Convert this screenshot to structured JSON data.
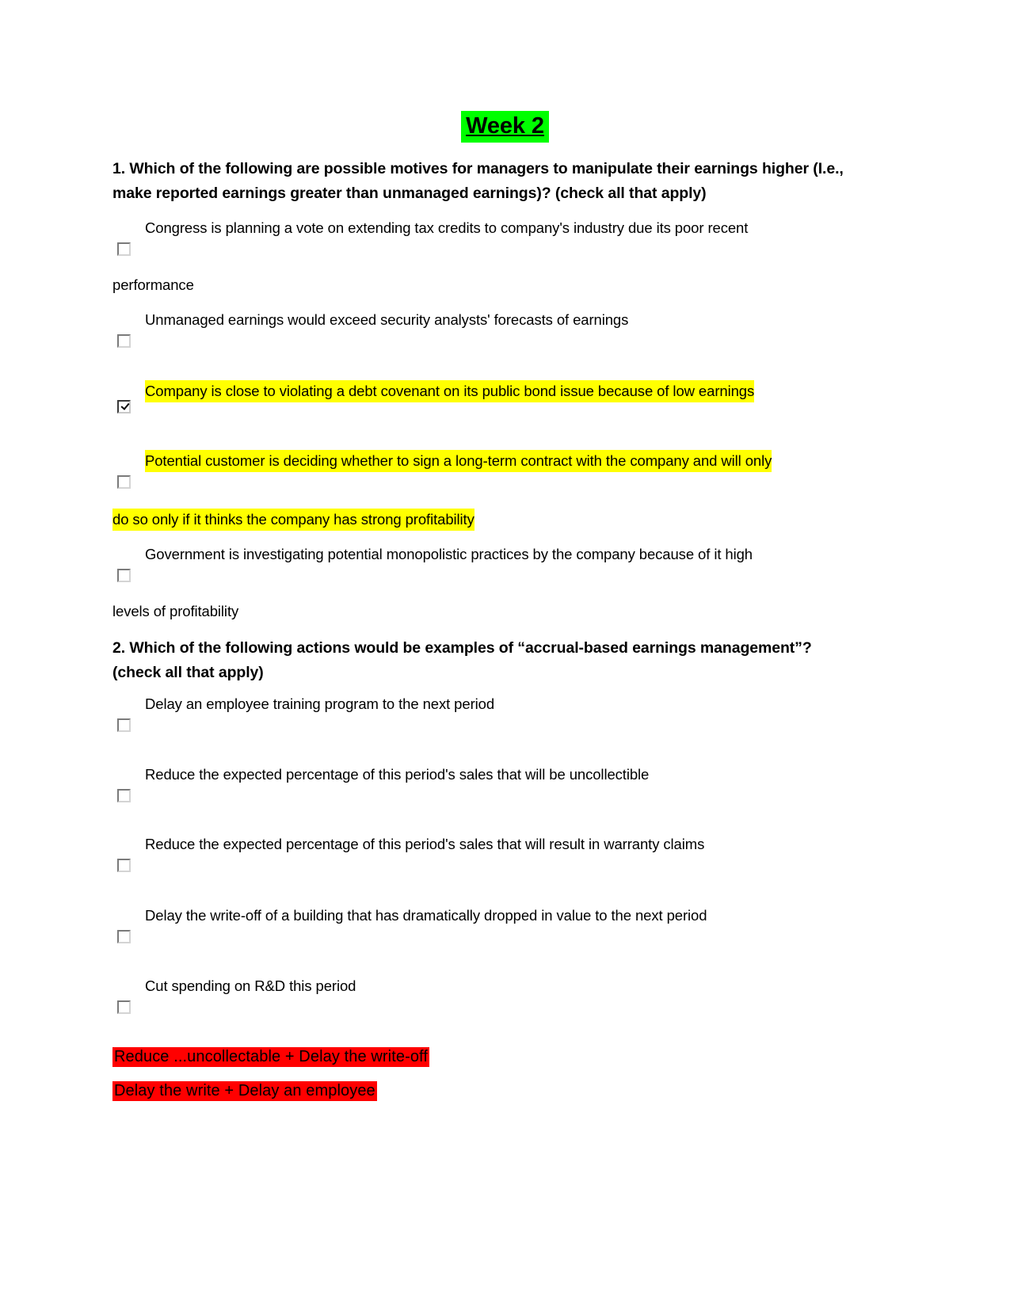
{
  "document": {
    "title": "Week 2",
    "title_highlight_color": "#00FF00",
    "yellow_highlight_color": "#FFFF00",
    "red_highlight_color": "#FF0000"
  },
  "questions": [
    {
      "number": "1.",
      "heading_line_1": "1. Which of the following are possible motives for managers to manipulate their earnings higher (I.e.,",
      "heading_line_2": "make reported earnings greater than unmanaged earnings)? (check all that apply)",
      "options": [
        {
          "checked": false,
          "highlighted": false,
          "line_1": "Congress is planning a vote on extending tax credits to company's industry due its poor recent",
          "line_2": "performance"
        },
        {
          "checked": false,
          "highlighted": false,
          "line_1": "Unmanaged earnings would exceed security analysts' forecasts of earnings",
          "line_2": ""
        },
        {
          "checked": true,
          "highlighted": true,
          "line_1": "Company is close to violating a debt covenant on its public bond issue because of low earnings",
          "line_2": ""
        },
        {
          "checked": false,
          "highlighted": true,
          "line_1": "Potential customer is deciding whether to sign a long-term contract with the company and will only",
          "line_2": "do so only if it thinks the company has strong profitability"
        },
        {
          "checked": false,
          "highlighted": false,
          "line_1": "Government is investigating potential monopolistic practices by the company because of it high",
          "line_2": "levels of profitability"
        }
      ]
    },
    {
      "number": "2.",
      "heading_line_1": "2. Which of the following actions would be examples of “accrual-based earnings management”?",
      "heading_line_2": "(check all that apply)",
      "options": [
        {
          "checked": false,
          "highlighted": false,
          "line_1": "Delay an employee training program to the next period",
          "line_2": ""
        },
        {
          "checked": false,
          "highlighted": false,
          "line_1": "Reduce the expected percentage of this period's sales that will be uncollectible",
          "line_2": ""
        },
        {
          "checked": false,
          "highlighted": false,
          "line_1": "Reduce the expected percentage of this period's sales that will result in warranty claims",
          "line_2": ""
        },
        {
          "checked": false,
          "highlighted": false,
          "line_1": "Delay the write-off of a building that has dramatically dropped in value to the next period",
          "line_2": ""
        },
        {
          "checked": false,
          "highlighted": false,
          "line_1": "Cut spending on R&D this period",
          "line_2": ""
        }
      ]
    }
  ],
  "answers": [
    {
      "text": "Reduce ...uncollectable + Delay the write-off"
    },
    {
      "text": "Delay the write + Delay an employee"
    }
  ]
}
